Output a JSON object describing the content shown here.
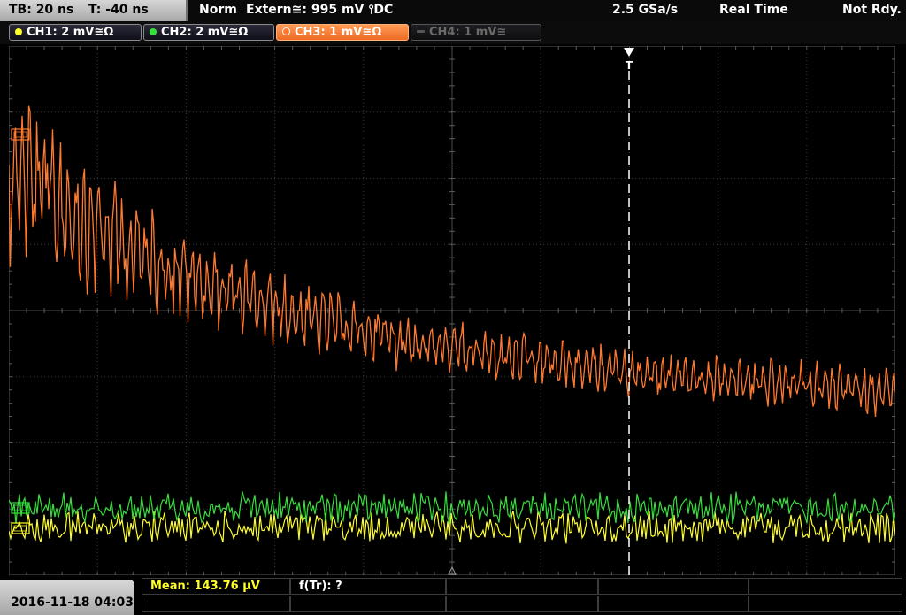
{
  "header": {
    "timebase": "TB: 20 ns",
    "trigger_time": "T: -40 ns",
    "trigger_mode": "Norm",
    "trigger_source": "Extern≅: 995 mV ⫯DC",
    "sample_rate": "2.5 GSa/s",
    "acquisition": "Real Time",
    "status": "Not Rdy."
  },
  "channels": [
    {
      "id": "ch1",
      "label": "CH1: 2 mV≅Ω",
      "color": "#ffff2a",
      "enabled": true
    },
    {
      "id": "ch2",
      "label": "CH2: 2 mV≅Ω",
      "color": "#35e03a",
      "enabled": true
    },
    {
      "id": "ch3",
      "label": "CH3: 1 mV≅Ω",
      "color": "#ff7a30",
      "enabled": true,
      "selected": true
    },
    {
      "id": "ch4",
      "label": "CH4: 1 mV≅",
      "color": "#555555",
      "enabled": false
    }
  ],
  "trigger_marker": {
    "label": "T"
  },
  "footer": {
    "datetime": "2016-11-18 04:03",
    "measurement_mean": "Mean: 143.76 µV",
    "measurement_ftr": "f(Tr): ?"
  },
  "colors": {
    "ch1": "#ffff2a",
    "ch2": "#35e03a",
    "ch3": "#ff7a30",
    "grid": "#3a3a3a",
    "trigger_line": "#ffffff"
  },
  "icons": [
    "channel-dot-icon",
    "trigger-marker-icon",
    "channel-offset-marker-icon"
  ]
}
